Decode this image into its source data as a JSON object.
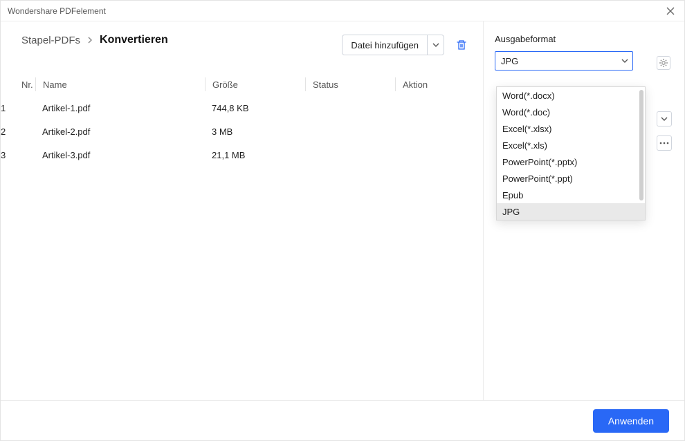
{
  "window": {
    "title": "Wondershare PDFelement"
  },
  "breadcrumb": {
    "prev": "Stapel-PDFs",
    "current": "Konvertieren"
  },
  "toolbar": {
    "add_label": "Datei hinzufügen"
  },
  "table": {
    "headers": {
      "nr": "Nr.",
      "name": "Name",
      "size": "Größe",
      "status": "Status",
      "action": "Aktion"
    },
    "rows": [
      {
        "nr": "1",
        "name": "Artikel-1.pdf",
        "size": "744,8 KB"
      },
      {
        "nr": "2",
        "name": "Artikel-2.pdf",
        "size": "3 MB"
      },
      {
        "nr": "3",
        "name": "Artikel-3.pdf",
        "size": "21,1 MB"
      }
    ]
  },
  "sidebar": {
    "format_label": "Ausgabeformat",
    "selected": "JPG",
    "options": [
      "Word(*.docx)",
      "Word(*.doc)",
      "Excel(*.xlsx)",
      "Excel(*.xls)",
      "PowerPoint(*.pptx)",
      "PowerPoint(*.ppt)",
      "Epub",
      "JPG"
    ]
  },
  "footer": {
    "apply": "Anwenden"
  }
}
